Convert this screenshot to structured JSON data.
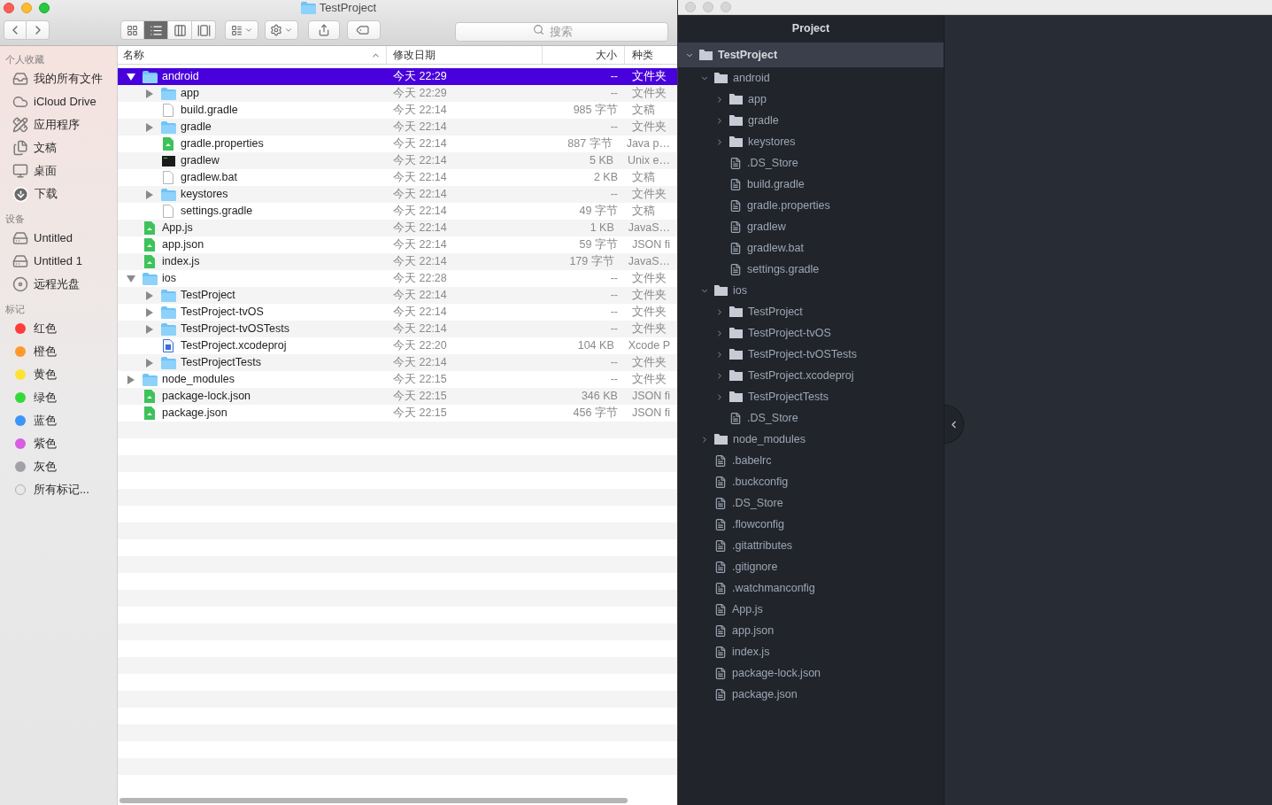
{
  "finder": {
    "title": "TestProject",
    "search": {
      "placeholder": "搜索"
    },
    "view_modes": [
      {
        "kind": "icons",
        "selected": false
      },
      {
        "kind": "list",
        "selected": true
      },
      {
        "kind": "columns",
        "selected": false
      },
      {
        "kind": "gallery",
        "selected": false
      }
    ],
    "sidebar": [
      {
        "heading": "个人收藏",
        "items": [
          {
            "label": "我的所有文件",
            "kind": "all-files"
          },
          {
            "label": "iCloud Drive",
            "kind": "icloud"
          },
          {
            "label": "应用程序",
            "kind": "apps"
          },
          {
            "label": "文稿",
            "kind": "docs"
          },
          {
            "label": "桌面",
            "kind": "desktop"
          },
          {
            "label": "下载",
            "kind": "downloads"
          }
        ]
      },
      {
        "heading": "设备",
        "items": [
          {
            "label": "Untitled",
            "kind": "disk"
          },
          {
            "label": "Untitled 1",
            "kind": "disk"
          },
          {
            "label": "远程光盘",
            "kind": "optical"
          }
        ]
      },
      {
        "heading": "标记",
        "items": [
          {
            "label": "红色",
            "kind": "tag",
            "color": "#fc3d39"
          },
          {
            "label": "橙色",
            "kind": "tag",
            "color": "#fd9a2b"
          },
          {
            "label": "黄色",
            "kind": "tag",
            "color": "#fee135"
          },
          {
            "label": "绿色",
            "kind": "tag",
            "color": "#35d83b"
          },
          {
            "label": "蓝色",
            "kind": "tag",
            "color": "#3e94f8"
          },
          {
            "label": "紫色",
            "kind": "tag",
            "color": "#d85ee0"
          },
          {
            "label": "灰色",
            "kind": "tag",
            "color": "#a2a2a6"
          },
          {
            "label": "所有标记...",
            "kind": "all-tags"
          }
        ]
      }
    ],
    "columns": [
      "名称",
      "修改日期",
      "大小",
      "种类"
    ],
    "rows": [
      {
        "name": "android",
        "date": "今天 22:29",
        "size": "--",
        "kind_label": "文件夹",
        "kind": "folder",
        "expanded": true,
        "selected": true,
        "children": [
          {
            "name": "app",
            "date": "今天 22:29",
            "size": "--",
            "kind_label": "文件夹",
            "kind": "folder",
            "expanded": false,
            "selected": false
          },
          {
            "name": "build.gradle",
            "date": "今天 22:14",
            "size": "985 字节",
            "kind_label": "文稿",
            "kind": "doc",
            "selected": false
          },
          {
            "name": "gradle",
            "date": "今天 22:14",
            "size": "--",
            "kind_label": "文件夹",
            "kind": "folder",
            "expanded": false,
            "selected": false
          },
          {
            "name": "gradle.properties",
            "date": "今天 22:14",
            "size": "887 字节",
            "kind_label": "Java p…",
            "kind": "script",
            "selected": false
          },
          {
            "name": "gradlew",
            "date": "今天 22:14",
            "size": "5 KB",
            "kind_label": "Unix e…",
            "kind": "exec",
            "selected": false
          },
          {
            "name": "gradlew.bat",
            "date": "今天 22:14",
            "size": "2 KB",
            "kind_label": "文稿",
            "kind": "doc",
            "selected": false
          },
          {
            "name": "keystores",
            "date": "今天 22:14",
            "size": "--",
            "kind_label": "文件夹",
            "kind": "folder",
            "expanded": false,
            "selected": false
          },
          {
            "name": "settings.gradle",
            "date": "今天 22:14",
            "size": "49 字节",
            "kind_label": "文稿",
            "kind": "doc",
            "selected": false
          }
        ]
      },
      {
        "name": "App.js",
        "date": "今天 22:14",
        "size": "1 KB",
        "kind_label": "JavaS…",
        "kind": "script",
        "selected": false
      },
      {
        "name": "app.json",
        "date": "今天 22:14",
        "size": "59 字节",
        "kind_label": "JSON fi",
        "kind": "script",
        "selected": false
      },
      {
        "name": "index.js",
        "date": "今天 22:14",
        "size": "179 字节",
        "kind_label": "JavaS…",
        "kind": "script",
        "selected": false
      },
      {
        "name": "ios",
        "date": "今天 22:28",
        "size": "--",
        "kind_label": "文件夹",
        "kind": "folder",
        "expanded": true,
        "selected": false,
        "children": [
          {
            "name": "TestProject",
            "date": "今天 22:14",
            "size": "--",
            "kind_label": "文件夹",
            "kind": "folder",
            "expanded": false,
            "selected": false
          },
          {
            "name": "TestProject-tvOS",
            "date": "今天 22:14",
            "size": "--",
            "kind_label": "文件夹",
            "kind": "folder",
            "expanded": false,
            "selected": false
          },
          {
            "name": "TestProject-tvOSTests",
            "date": "今天 22:14",
            "size": "--",
            "kind_label": "文件夹",
            "kind": "folder",
            "expanded": false,
            "selected": false
          },
          {
            "name": "TestProject.xcodeproj",
            "date": "今天 22:20",
            "size": "104 KB",
            "kind_label": "Xcode P",
            "kind": "xcode",
            "selected": false
          },
          {
            "name": "TestProjectTests",
            "date": "今天 22:14",
            "size": "--",
            "kind_label": "文件夹",
            "kind": "folder",
            "expanded": false,
            "selected": false
          }
        ]
      },
      {
        "name": "node_modules",
        "date": "今天 22:15",
        "size": "--",
        "kind_label": "文件夹",
        "kind": "folder",
        "expanded": false,
        "selected": false
      },
      {
        "name": "package-lock.json",
        "date": "今天 22:15",
        "size": "346 KB",
        "kind_label": "JSON fi",
        "kind": "script",
        "selected": false
      },
      {
        "name": "package.json",
        "date": "今天 22:15",
        "size": "456 字节",
        "kind_label": "JSON fi",
        "kind": "script",
        "selected": false
      }
    ]
  },
  "atom": {
    "title": "Project",
    "tree": [
      {
        "name": "TestProject",
        "kind": "folder",
        "expanded": true,
        "selected": true,
        "children": [
          {
            "name": "android",
            "kind": "folder",
            "expanded": true,
            "selected": false,
            "children": [
              {
                "name": "app",
                "kind": "folder",
                "expanded": false,
                "selected": false
              },
              {
                "name": "gradle",
                "kind": "folder",
                "expanded": false,
                "selected": false
              },
              {
                "name": "keystores",
                "kind": "folder",
                "expanded": false,
                "selected": false
              },
              {
                "name": ".DS_Store",
                "kind": "file",
                "selected": false
              },
              {
                "name": "build.gradle",
                "kind": "file",
                "selected": false
              },
              {
                "name": "gradle.properties",
                "kind": "file",
                "selected": false
              },
              {
                "name": "gradlew",
                "kind": "file",
                "selected": false
              },
              {
                "name": "gradlew.bat",
                "kind": "file",
                "selected": false
              },
              {
                "name": "settings.gradle",
                "kind": "file",
                "selected": false
              }
            ]
          },
          {
            "name": "ios",
            "kind": "folder",
            "expanded": true,
            "selected": false,
            "children": [
              {
                "name": "TestProject",
                "kind": "folder",
                "expanded": false,
                "selected": false
              },
              {
                "name": "TestProject-tvOS",
                "kind": "folder",
                "expanded": false,
                "selected": false
              },
              {
                "name": "TestProject-tvOSTests",
                "kind": "folder",
                "expanded": false,
                "selected": false
              },
              {
                "name": "TestProject.xcodeproj",
                "kind": "folder",
                "expanded": false,
                "selected": false
              },
              {
                "name": "TestProjectTests",
                "kind": "folder",
                "expanded": false,
                "selected": false
              },
              {
                "name": ".DS_Store",
                "kind": "file",
                "selected": false
              }
            ]
          },
          {
            "name": "node_modules",
            "kind": "folder",
            "expanded": false,
            "selected": false
          },
          {
            "name": ".babelrc",
            "kind": "file",
            "selected": false
          },
          {
            "name": ".buckconfig",
            "kind": "file",
            "selected": false
          },
          {
            "name": ".DS_Store",
            "kind": "file",
            "selected": false
          },
          {
            "name": ".flowconfig",
            "kind": "file",
            "selected": false
          },
          {
            "name": ".gitattributes",
            "kind": "file",
            "selected": false
          },
          {
            "name": ".gitignore",
            "kind": "file",
            "selected": false
          },
          {
            "name": ".watchmanconfig",
            "kind": "file",
            "selected": false
          },
          {
            "name": "App.js",
            "kind": "file",
            "selected": false
          },
          {
            "name": "app.json",
            "kind": "file",
            "selected": false
          },
          {
            "name": "index.js",
            "kind": "file",
            "selected": false
          },
          {
            "name": "package-lock.json",
            "kind": "file",
            "selected": false
          },
          {
            "name": "package.json",
            "kind": "file",
            "selected": false
          }
        ]
      }
    ]
  }
}
